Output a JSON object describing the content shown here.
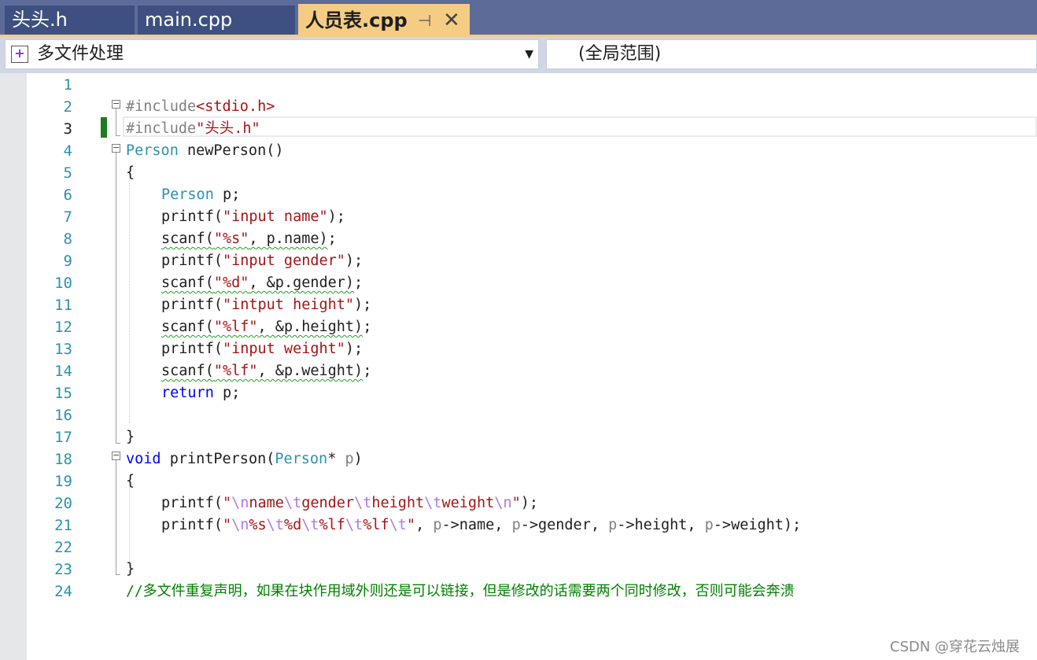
{
  "tabs": [
    {
      "label": "头头.h",
      "active": false
    },
    {
      "label": "main.cpp",
      "active": false
    },
    {
      "label": "人员表.cpp",
      "active": true
    }
  ],
  "tab_pin_glyph": "⊣",
  "tab_close_glyph": "✕",
  "navbar": {
    "project": "多文件处理",
    "scope": "(全局范围)",
    "dropdown_glyph": "▼"
  },
  "editor": {
    "current_line": 3,
    "line_numbers": [
      "1",
      "2",
      "3",
      "4",
      "5",
      "6",
      "7",
      "8",
      "9",
      "10",
      "11",
      "12",
      "13",
      "14",
      "15",
      "16",
      "17",
      "18",
      "19",
      "20",
      "21",
      "22",
      "23",
      "24"
    ],
    "lines": {
      "l2": [
        "#include",
        "<stdio.h>"
      ],
      "l3": [
        "#include",
        "\"头头.h\""
      ],
      "l4": [
        "Person",
        " newPerson()"
      ],
      "l5": "{",
      "l6": [
        "Person",
        " p;"
      ],
      "l7": [
        "printf(",
        "\"input name\"",
        ");"
      ],
      "l8": [
        "scanf(",
        "\"%s\"",
        ", p.name)",
        ";"
      ],
      "l9": [
        "printf(",
        "\"input gender\"",
        ");"
      ],
      "l10": [
        "scanf(",
        "\"%d\"",
        ", &p.gender)",
        ";"
      ],
      "l11": [
        "printf(",
        "\"intput height\"",
        ");"
      ],
      "l12": [
        "scanf(",
        "\"%lf\"",
        ", &p.height)",
        ";"
      ],
      "l13": [
        "printf(",
        "\"input weight\"",
        ");"
      ],
      "l14": [
        "scanf(",
        "\"%lf\"",
        ", &p.weight)",
        ";"
      ],
      "l15": [
        "return",
        " p;"
      ],
      "l17": "}",
      "l18": [
        "void",
        " printPerson(",
        "Person",
        "* ",
        "p",
        ")"
      ],
      "l19": "{",
      "l20": [
        "printf(",
        "\"",
        "\\n",
        "name",
        "\\t",
        "gender",
        "\\t",
        "height",
        "\\t",
        "weight",
        "\\n",
        "\"",
        ");"
      ],
      "l21": [
        "printf(",
        "\"",
        "\\n",
        "%s",
        "\\t",
        "%d",
        "\\t",
        "%lf",
        "\\t",
        "%lf",
        "\\t",
        "\"",
        ", ",
        "p",
        "->name, ",
        "p",
        "->gender, ",
        "p",
        "->height, ",
        "p",
        "->weight);"
      ],
      "l23": "}",
      "l24": "//多文件重复声明，如果在块作用域外则还是可以链接，但是修改的话需要两个同时修改，否则可能会奔溃"
    }
  },
  "watermark": "CSDN @穿花云烛展",
  "colors": {
    "keyword": "#0000ff",
    "type": "#2b91af",
    "string": "#a31515",
    "escape": "#b07ae0",
    "comment": "#008000",
    "tab_active": "#f5cc84",
    "tab_inactive": "#3e5081",
    "tabstrip": "#5d6b99"
  }
}
